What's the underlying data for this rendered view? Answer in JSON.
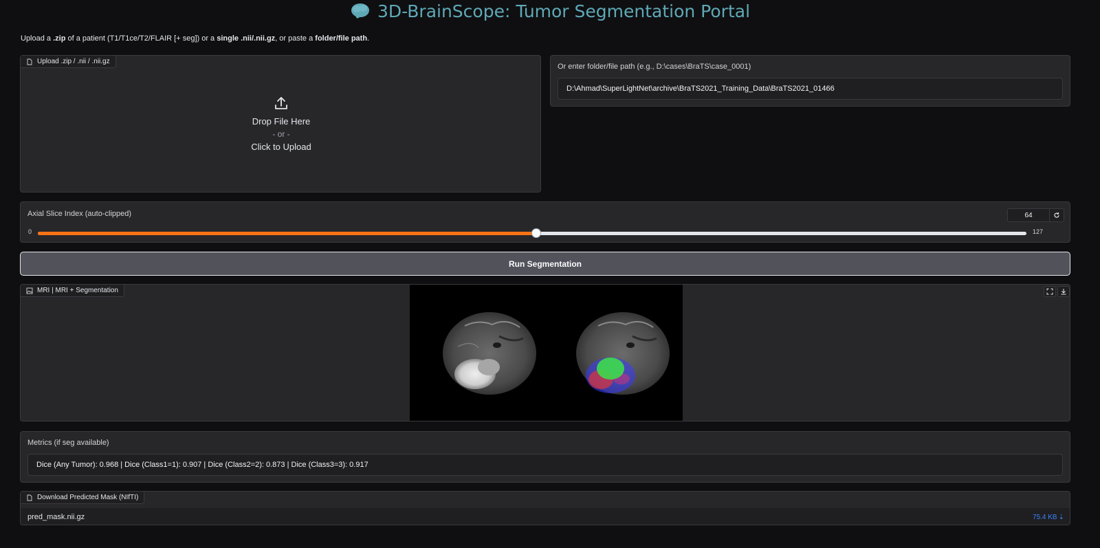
{
  "header": {
    "title": "3D-BrainScope: Tumor Segmentation Portal",
    "title_color": "#5fa9b6",
    "icon": "brain-icon"
  },
  "instructions": {
    "p1": "Upload a ",
    "b1": ".zip",
    "p2": " of a patient (T1/T1ce/T2/FLAIR [+ seg]) or a ",
    "b2": "single .nii/.nii.gz",
    "p3": ", or paste a ",
    "b3": "folder/file path",
    "p4": "."
  },
  "upload": {
    "tab_label": "Upload .zip / .nii / .nii.gz",
    "drop_text": "Drop File Here",
    "or_text": "- or -",
    "click_text": "Click to Upload"
  },
  "path_input": {
    "label": "Or enter folder/file path (e.g., D:\\cases\\BraTS\\case_0001)",
    "value": "D:\\Ahmad\\SuperLightNet\\archive\\BraTS2021_Training_Data\\BraTS2021_01466"
  },
  "slider": {
    "label": "Axial Slice Index (auto-clipped)",
    "min_label": "0",
    "max_label": "127",
    "min": 0,
    "max": 127,
    "value": 64,
    "value_text": "64",
    "reset_icon": "reset-icon",
    "accent": "#f97316"
  },
  "run_button": {
    "label": "Run Segmentation"
  },
  "image_output": {
    "tab_label": "MRI | MRI + Segmentation",
    "fullscreen_icon": "fullscreen-icon",
    "download_icon": "download-icon"
  },
  "metrics": {
    "label": "Metrics (if seg available)",
    "value": "Dice (Any Tumor): 0.968 | Dice (Class1=1): 0.907 | Dice (Class2=2): 0.873 | Dice (Class3=3): 0.917"
  },
  "download": {
    "tab_label": "Download Predicted Mask (NIfTI)",
    "file_name": "pred_mask.nii.gz",
    "file_size": "75.4 KB",
    "size_color": "#3b82f6"
  }
}
